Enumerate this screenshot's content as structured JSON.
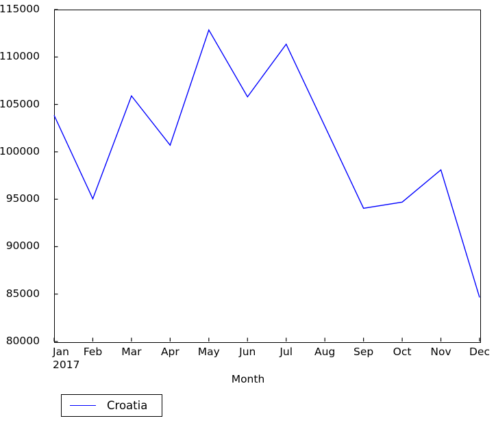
{
  "chart_data": {
    "type": "line",
    "title": "",
    "xlabel": "Month",
    "ylabel": "",
    "categories": [
      "Jan",
      "Feb",
      "Mar",
      "Apr",
      "May",
      "Jun",
      "Jul",
      "Aug",
      "Sep",
      "Oct",
      "Nov",
      "Dec"
    ],
    "x_sub_label": "2017",
    "series": [
      {
        "name": "Croatia",
        "color": "#0000ff",
        "values": [
          103850,
          95050,
          105900,
          100700,
          112850,
          105800,
          111350,
          102700,
          94050,
          94700,
          98100,
          84650
        ]
      }
    ],
    "ylim": [
      80000,
      115000
    ],
    "ytick_labels": [
      "80000",
      "85000",
      "90000",
      "95000",
      "100000",
      "105000",
      "110000",
      "115000"
    ],
    "ytick_values": [
      80000,
      85000,
      90000,
      95000,
      100000,
      105000,
      110000,
      115000
    ],
    "grid": false,
    "legend_position": "below-left",
    "legend_entries": [
      "Croatia"
    ]
  }
}
